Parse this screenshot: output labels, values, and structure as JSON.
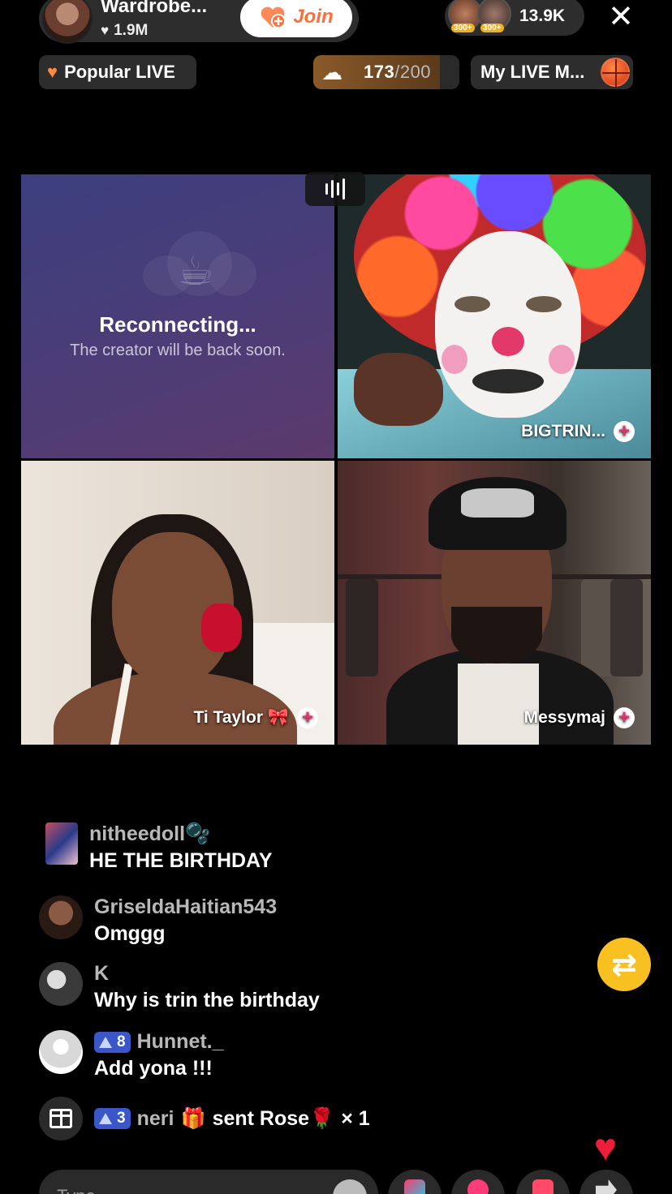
{
  "host": {
    "name": "Wardrobe...",
    "likes": "1.9M",
    "join_label": "Join"
  },
  "viewers": {
    "badges": [
      "300+",
      "300+"
    ],
    "count": "13.9K",
    "close_glyph": "✕"
  },
  "chips": {
    "popular_label": "Popular LIVE",
    "goal_current": "173",
    "goal_total": "/200",
    "goal_progress": 0.865,
    "my_live_label": "My LIVE M..."
  },
  "tiles": {
    "reconnect_title": "Reconnecting...",
    "reconnect_sub": "The creator will be back soon.",
    "guest_top_right": "BIGTRIN...",
    "guest_bottom_left": "Ti  Taylor 🎀",
    "guest_bottom_right": "Messymaj"
  },
  "comments": [
    {
      "user": "nitheedoll🫧",
      "text": "HE THE BIRTHDAY"
    },
    {
      "user": "GriseldaHaitian543",
      "text": "Omggg"
    },
    {
      "user": "K",
      "text": "Why is trin the birthday"
    },
    {
      "user": "Hunnet._",
      "level": "8",
      "text": "Add yona !!!"
    }
  ],
  "gift": {
    "level": "3",
    "user": "neri",
    "sent_text": "sent Rose🌹",
    "count": "× 1"
  },
  "bottom": {
    "input_placeholder": "Type..."
  },
  "colors": {
    "join_text": "#fe6d3a",
    "level_badge": "#3a56c8",
    "repost": "#f8c020",
    "heart": "#ee1d3a",
    "plus": "#e0336b"
  }
}
